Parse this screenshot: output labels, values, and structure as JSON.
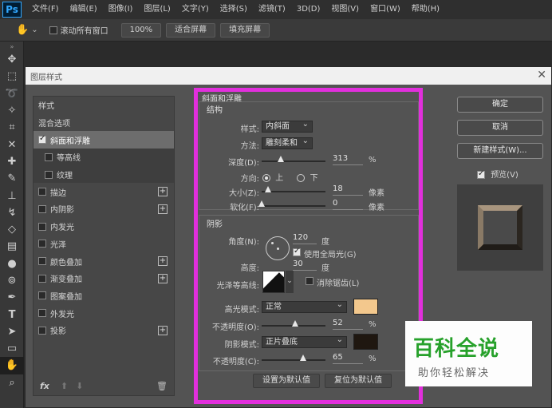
{
  "app": {
    "logo": "Ps",
    "menu": [
      "文件(F)",
      "编辑(E)",
      "图像(I)",
      "图层(L)",
      "文字(Y)",
      "选择(S)",
      "滤镜(T)",
      "3D(D)",
      "视图(V)",
      "窗口(W)",
      "帮助(H)"
    ]
  },
  "options_bar": {
    "scroll_all_windows": "滚动所有窗口",
    "zoom": "100%",
    "fit_screen": "适合屏幕",
    "fill_screen": "填充屏幕"
  },
  "dialog": {
    "title": "图层样式",
    "styles_header": "样式",
    "blending_options": "混合选项",
    "styles": [
      {
        "label": "斜面和浮雕",
        "checked": true,
        "selected": true,
        "plus": false
      },
      {
        "label": "等高线",
        "checked": false,
        "sub": true,
        "plus": false
      },
      {
        "label": "纹理",
        "checked": false,
        "sub": true,
        "plus": false
      },
      {
        "label": "描边",
        "checked": false,
        "plus": true
      },
      {
        "label": "内阴影",
        "checked": false,
        "plus": true
      },
      {
        "label": "内发光",
        "checked": false,
        "plus": false
      },
      {
        "label": "光泽",
        "checked": false,
        "plus": false
      },
      {
        "label": "颜色叠加",
        "checked": false,
        "plus": true
      },
      {
        "label": "渐变叠加",
        "checked": false,
        "plus": true
      },
      {
        "label": "图案叠加",
        "checked": false,
        "plus": false
      },
      {
        "label": "外发光",
        "checked": false,
        "plus": false
      },
      {
        "label": "投影",
        "checked": false,
        "plus": true
      }
    ],
    "fx_label": "fx",
    "bevel": {
      "section_title": "斜面和浮雕",
      "structure_title": "结构",
      "style_label": "样式:",
      "style_value": "内斜面",
      "technique_label": "方法:",
      "technique_value": "雕刻柔和",
      "depth_label": "深度(D):",
      "depth_value": "313",
      "depth_unit": "%",
      "depth_level": 0.3,
      "direction_label": "方向:",
      "direction_up": "上",
      "direction_down": "下",
      "size_label": "大小(Z):",
      "size_value": "18",
      "size_unit": "像素",
      "size_level": 0.1,
      "soften_label": "软化(F):",
      "soften_value": "0",
      "soften_unit": "像素",
      "soften_level": 0.0
    },
    "shading": {
      "title": "阴影",
      "angle_label": "角度(N):",
      "angle_value": "120",
      "angle_unit": "度",
      "global_light_label": "使用全局光(G)",
      "altitude_label": "高度:",
      "altitude_value": "30",
      "altitude_unit": "度",
      "gloss_contour_label": "光泽等高线:",
      "anti_aliased_label": "消除锯齿(L)",
      "highlight_mode_label": "高光模式:",
      "highlight_mode_value": "正常",
      "highlight_color": "#f3c88d",
      "highlight_opacity_label": "不透明度(O):",
      "highlight_opacity_value": "52",
      "highlight_opacity_level": 0.52,
      "shadow_mode_label": "阴影模式:",
      "shadow_mode_value": "正片叠底",
      "shadow_color": "#1f1710",
      "shadow_opacity_label": "不透明度(C):",
      "shadow_opacity_value": "65",
      "shadow_opacity_level": 0.65,
      "percent": "%"
    },
    "make_default": "设置为默认值",
    "reset_default": "复位为默认值",
    "ok": "确定",
    "cancel": "取消",
    "new_style": "新建样式(W)...",
    "preview": "预览(V)"
  },
  "watermark": {
    "title": "百科全说",
    "subtitle": "助你轻松解决"
  },
  "colors": {
    "highlight_border": "#e22fdd",
    "watermark_green": "#27a12b"
  }
}
